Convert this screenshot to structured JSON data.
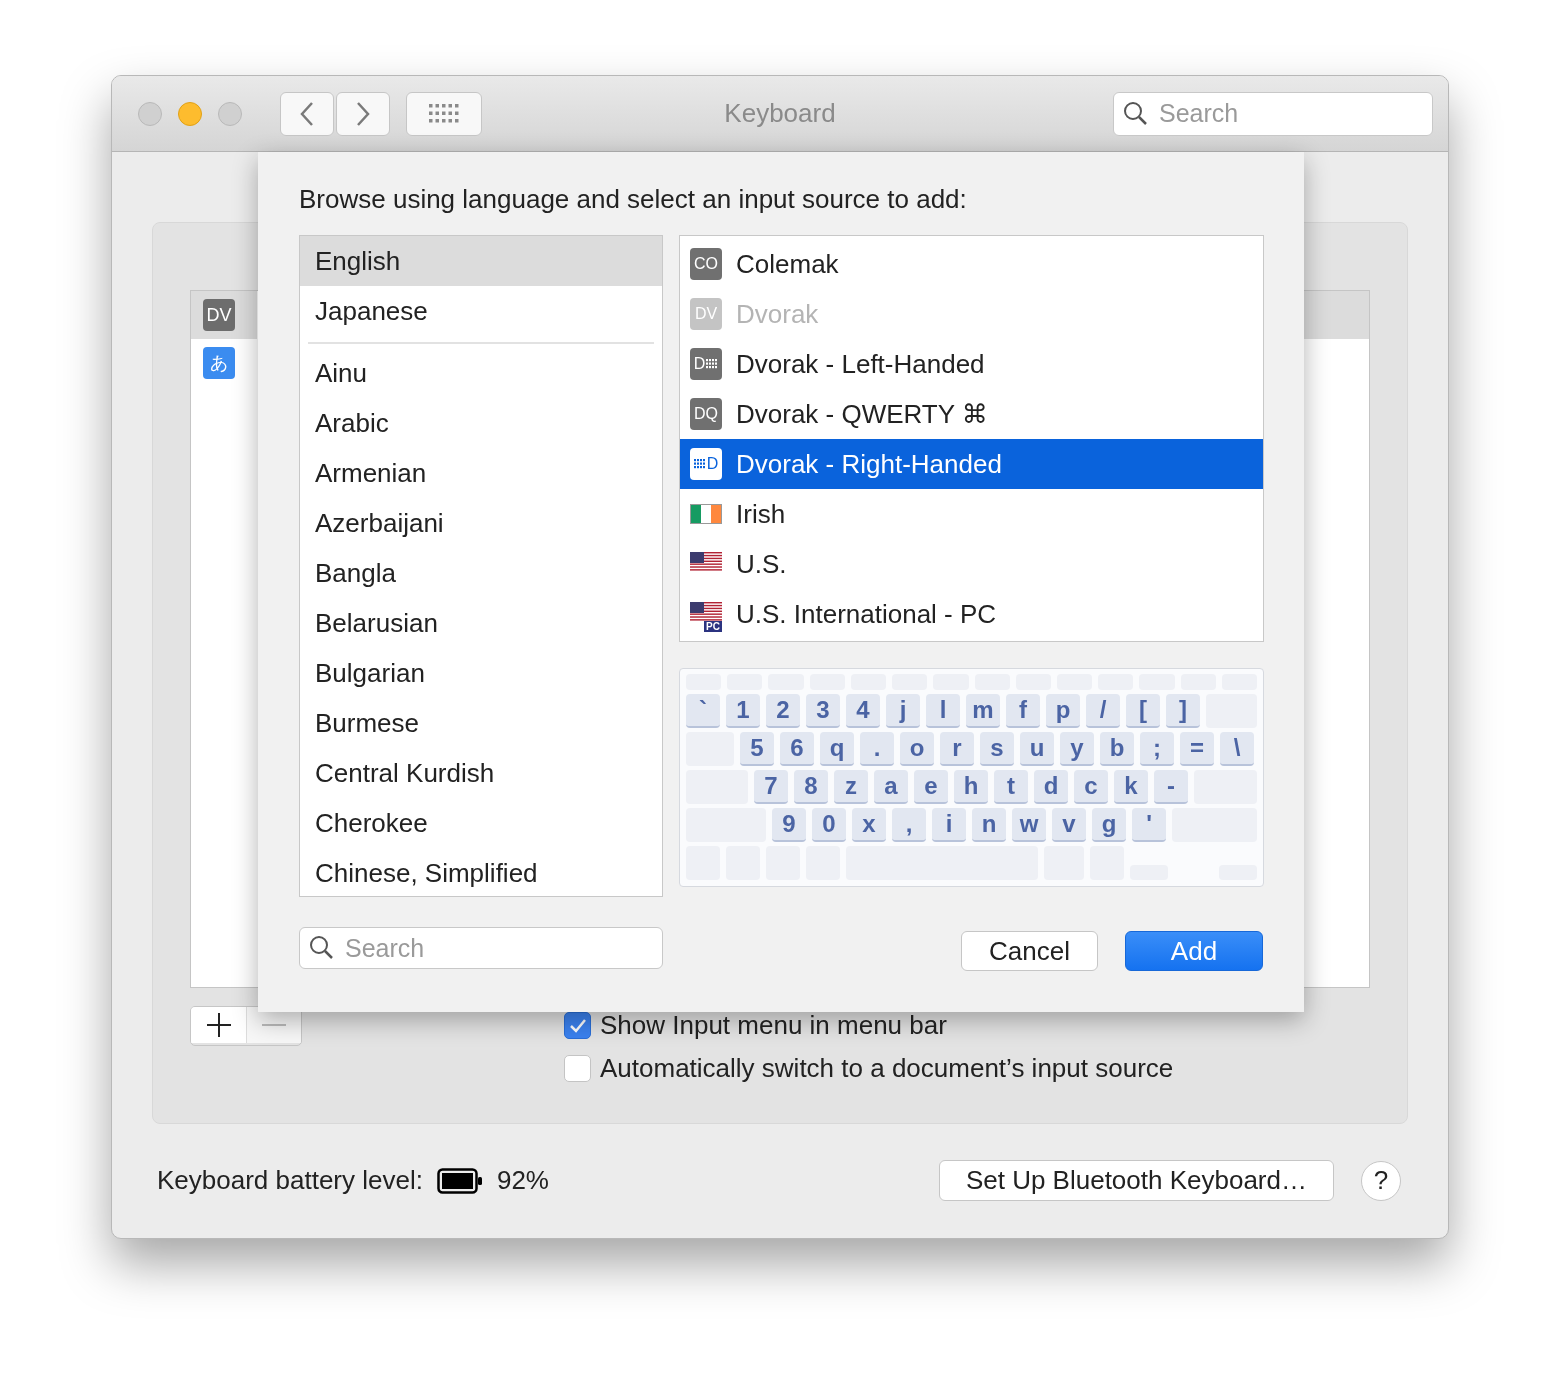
{
  "window": {
    "title": "Keyboard",
    "traffic_lights": [
      {
        "kind": "close",
        "enabled": false
      },
      {
        "kind": "minimize",
        "enabled": true
      },
      {
        "kind": "zoom",
        "enabled": false
      }
    ],
    "search": {
      "placeholder": "Search"
    }
  },
  "input_sources": [
    {
      "icon_text": "DV",
      "color": "#6d6d6d",
      "selected": true
    },
    {
      "icon_text": "あ",
      "color": "#3b8cf0",
      "selected": false
    }
  ],
  "sheet": {
    "prompt": "Browse using language and select an input source to add:",
    "preferred_languages": [
      {
        "label": "English",
        "selected": true
      },
      {
        "label": "Japanese",
        "selected": false
      }
    ],
    "languages": [
      {
        "label": "Ainu",
        "selected": false
      },
      {
        "label": "Arabic",
        "selected": false
      },
      {
        "label": "Armenian",
        "selected": false
      },
      {
        "label": "Azerbaijani",
        "selected": false
      },
      {
        "label": "Bangla",
        "selected": false
      },
      {
        "label": "Belarusian",
        "selected": false
      },
      {
        "label": "Bulgarian",
        "selected": false
      },
      {
        "label": "Burmese",
        "selected": false
      },
      {
        "label": "Central Kurdish",
        "selected": false
      },
      {
        "label": "Cherokee",
        "selected": false
      },
      {
        "label": "Chinese, Simplified",
        "selected": false
      }
    ],
    "layouts": [
      {
        "label": "Colemak",
        "kind": "badge",
        "icon_text": "CO",
        "disabled": false,
        "selected": false
      },
      {
        "label": "Dvorak",
        "kind": "badge",
        "icon_text": "DV",
        "disabled": true,
        "selected": false
      },
      {
        "label": "Dvorak - Left-Handed",
        "kind": "keysright",
        "icon_text": "D",
        "disabled": false,
        "selected": false
      },
      {
        "label": "Dvorak - QWERTY ⌘",
        "kind": "badge",
        "icon_text": "DQ",
        "disabled": false,
        "selected": false
      },
      {
        "label": "Dvorak - Right-Handed",
        "kind": "keysleft",
        "icon_text": "D",
        "disabled": false,
        "selected": true
      },
      {
        "label": "Irish",
        "kind": "irish",
        "disabled": false,
        "selected": false
      },
      {
        "label": "U.S.",
        "kind": "us",
        "disabled": false,
        "selected": false
      },
      {
        "label": "U.S. International - PC",
        "kind": "us",
        "icon_text": "PC",
        "disabled": false,
        "selected": false
      }
    ],
    "keyboard": [
      [
        "`",
        "1",
        "2",
        "3",
        "4",
        "j",
        "l",
        "m",
        "f",
        "p",
        "/",
        "[",
        "]"
      ],
      [
        "5",
        "6",
        "q",
        ".",
        "o",
        "r",
        "s",
        "u",
        "y",
        "b",
        ";",
        "=",
        "\\"
      ],
      [
        "7",
        "8",
        "z",
        "a",
        "e",
        "h",
        "t",
        "d",
        "c",
        "k",
        "-"
      ],
      [
        "9",
        "0",
        "x",
        ",",
        "i",
        "n",
        "w",
        "v",
        "g",
        "'"
      ]
    ],
    "search": {
      "placeholder": "Search"
    },
    "buttons": [
      {
        "label": "Cancel",
        "kind": "default"
      },
      {
        "label": "Add",
        "kind": "primary"
      }
    ]
  },
  "options": [
    {
      "label": "Show Input menu in menu bar",
      "checked": true
    },
    {
      "label": "Automatically switch to a document’s input source",
      "checked": false
    }
  ],
  "battery": {
    "label": "Keyboard battery level:",
    "reading": "92%"
  },
  "setup_button": "Set Up Bluetooth Keyboard…",
  "help_button": "?"
}
